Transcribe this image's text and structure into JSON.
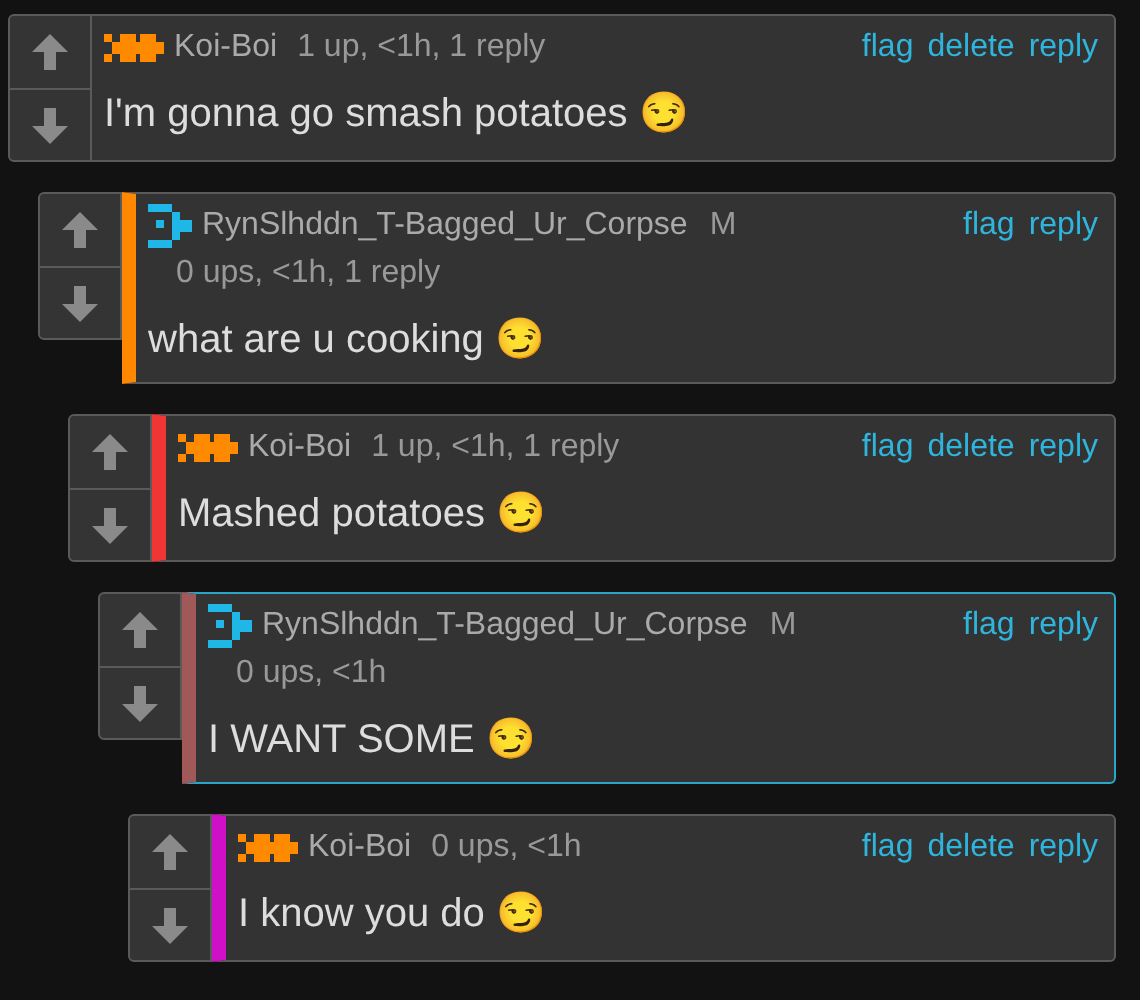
{
  "comments": [
    {
      "avatar": {
        "kind": "blocks"
      },
      "user": "Koi-Boi",
      "meta": "1 up, <1h, 1 reply",
      "actions": [
        "flag",
        "delete",
        "reply"
      ],
      "text": "I'm gonna go smash potatoes 😏",
      "highlighted": false,
      "children": [
        {
          "avatar": {
            "kind": "bracket"
          },
          "user": "RynSlhddn_T-Bagged_Ur_Corpse",
          "badge": "M",
          "meta": "0 ups, <1h, 1 reply",
          "actions": [
            "flag",
            "reply"
          ],
          "text": "what are u cooking 😏",
          "color": "#ff8800",
          "highlighted": false,
          "children": [
            {
              "avatar": {
                "kind": "blocks"
              },
              "user": "Koi-Boi",
              "meta": "1 up, <1h, 1 reply",
              "actions": [
                "flag",
                "delete",
                "reply"
              ],
              "text": "Mashed potatoes 😏",
              "color": "#f03535",
              "highlighted": false,
              "children": [
                {
                  "avatar": {
                    "kind": "bracket"
                  },
                  "user": "RynSlhddn_T-Bagged_Ur_Corpse",
                  "badge": "M",
                  "meta": "0 ups, <1h",
                  "actions": [
                    "flag",
                    "reply"
                  ],
                  "text": "I WANT SOME 😏",
                  "color": "#a05858",
                  "highlighted": true,
                  "children": [
                    {
                      "avatar": {
                        "kind": "blocks"
                      },
                      "user": "Koi-Boi",
                      "meta": "0 ups, <1h",
                      "actions": [
                        "flag",
                        "delete",
                        "reply"
                      ],
                      "text": "I know you do 😏",
                      "color": "#d010c8",
                      "highlighted": false
                    }
                  ]
                }
              ]
            }
          ]
        }
      ]
    }
  ]
}
